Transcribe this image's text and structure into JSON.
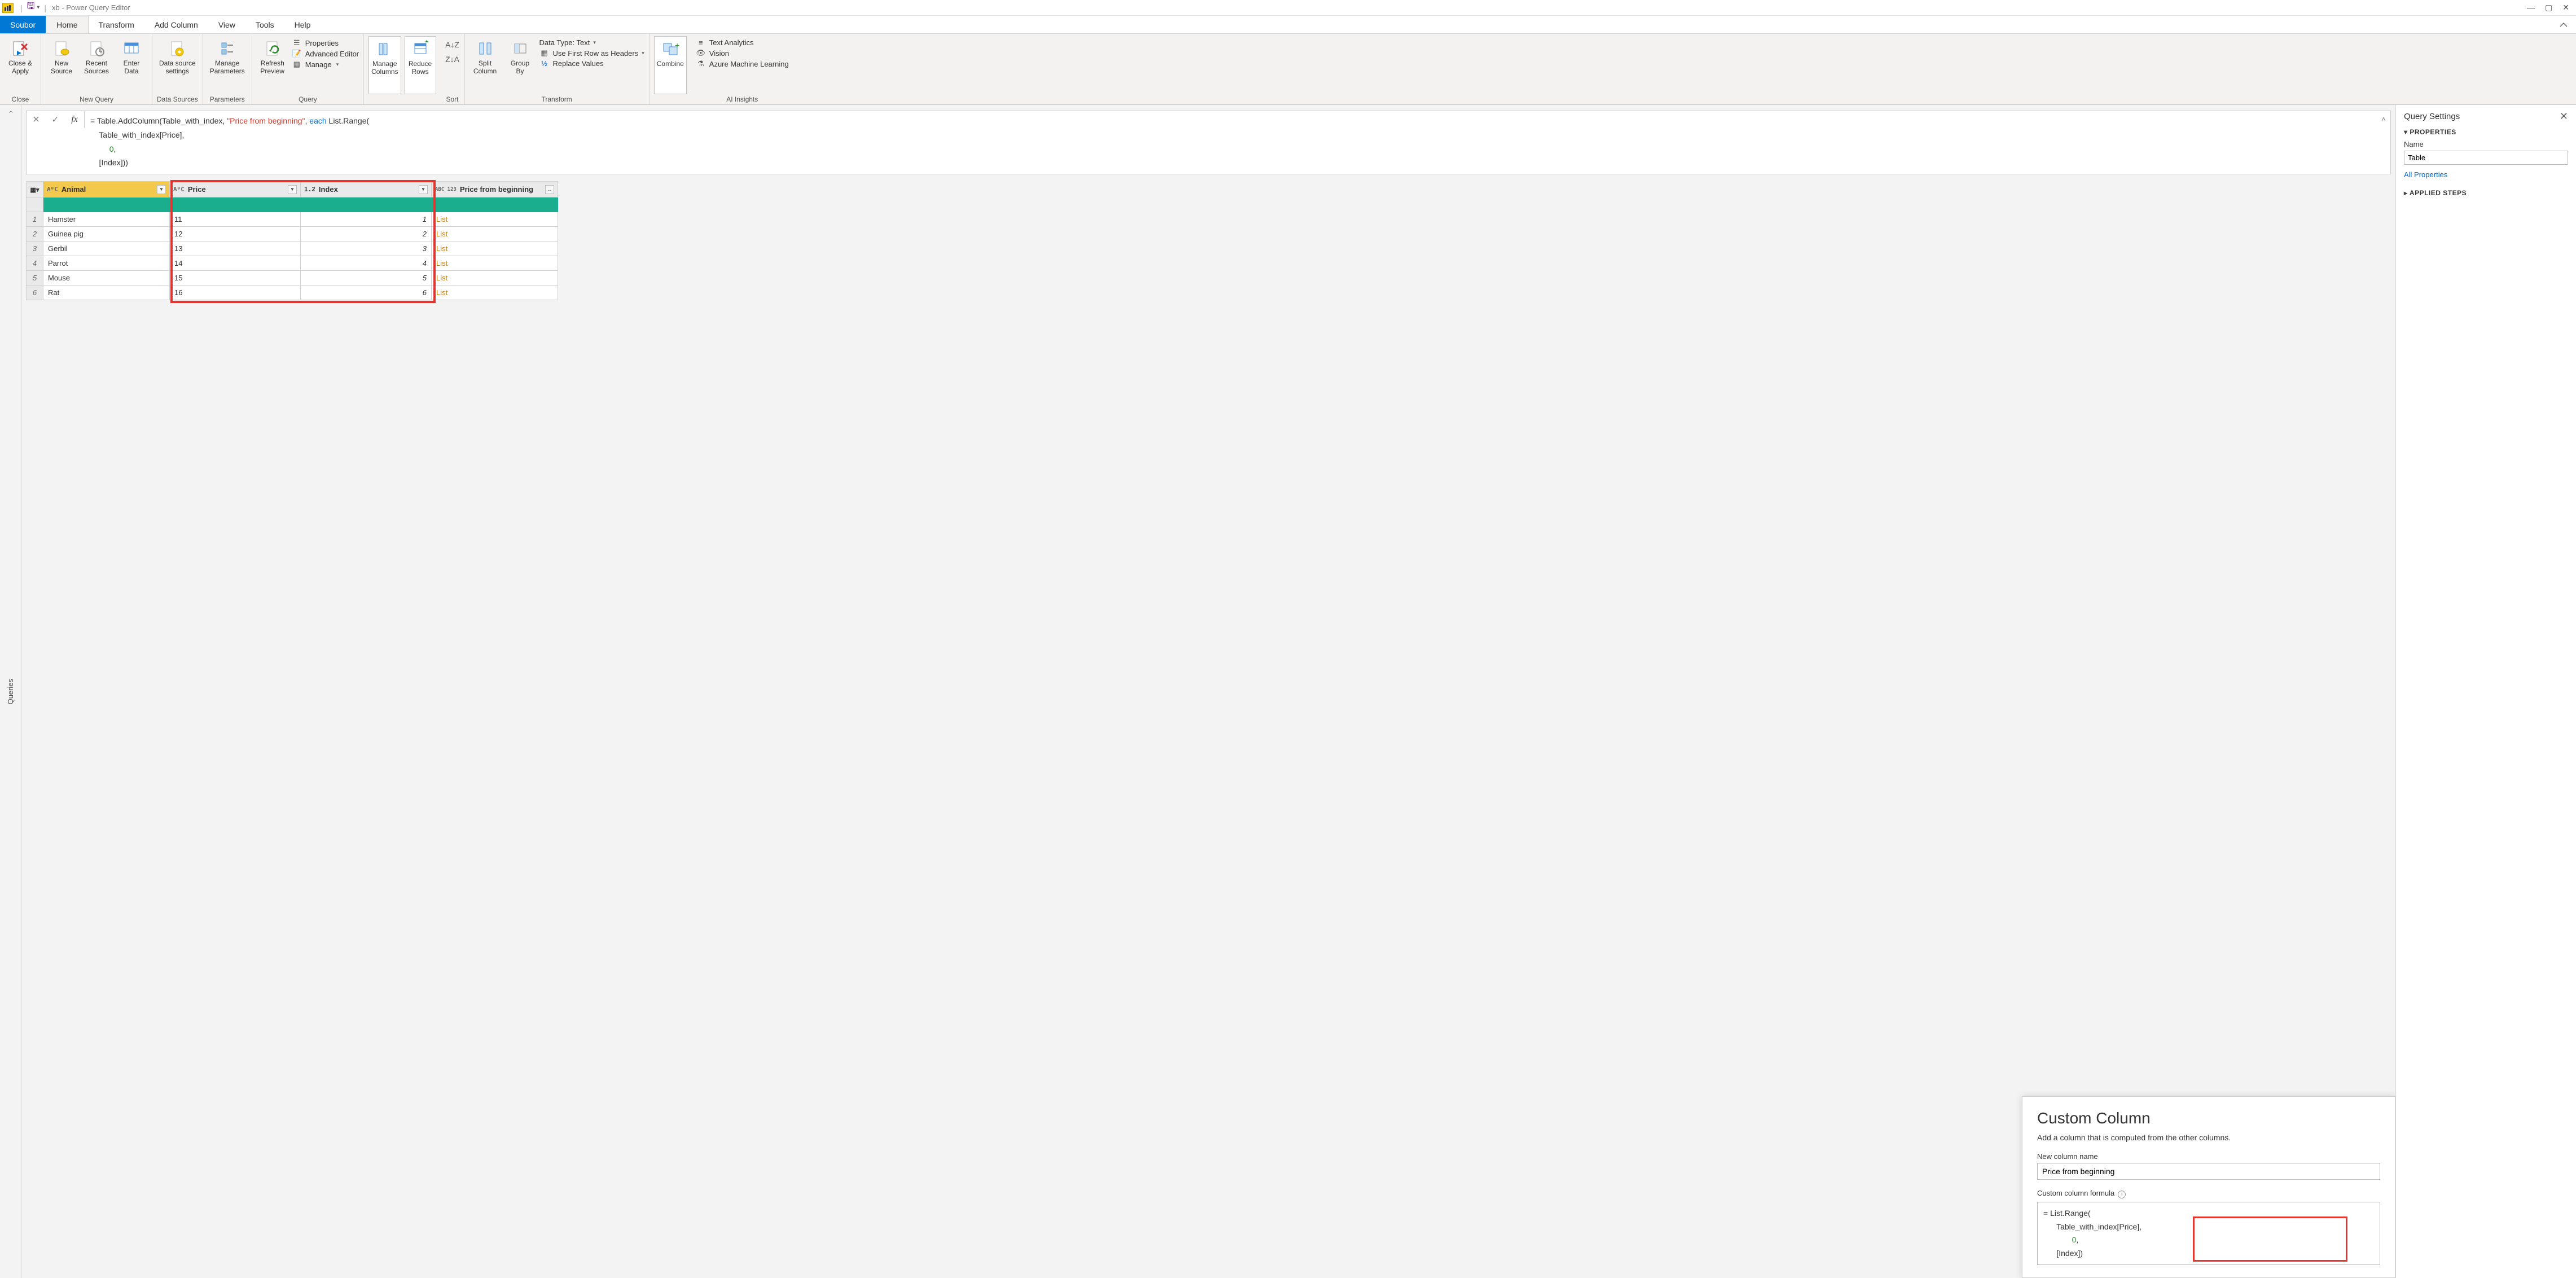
{
  "titlebar": {
    "title": "xb - Power Query Editor"
  },
  "menu": {
    "file": "Soubor",
    "tabs": [
      "Home",
      "Transform",
      "Add Column",
      "View",
      "Tools",
      "Help"
    ],
    "active": "Home"
  },
  "ribbon": {
    "close": {
      "btn": "Close &\nApply",
      "group": "Close"
    },
    "newquery": {
      "new": "New\nSource",
      "recent": "Recent\nSources",
      "enter": "Enter\nData",
      "group": "New Query"
    },
    "datasources": {
      "btn": "Data source\nsettings",
      "group": "Data Sources"
    },
    "parameters": {
      "btn": "Manage\nParameters",
      "group": "Parameters"
    },
    "query": {
      "refresh": "Refresh\nPreview",
      "props": "Properties",
      "adv": "Advanced Editor",
      "manage": "Manage",
      "group": "Query"
    },
    "managecols": {
      "manage": "Manage\nColumns",
      "reduce": "Reduce\nRows"
    },
    "sort": {
      "group": "Sort"
    },
    "transform": {
      "split": "Split\nColumn",
      "groupby": "Group\nBy",
      "datatype": "Data Type: Text",
      "firstrow": "Use First Row as Headers",
      "replace": "Replace Values",
      "group": "Transform"
    },
    "combine": {
      "btn": "Combine"
    },
    "ai": {
      "text": "Text Analytics",
      "vision": "Vision",
      "aml": "Azure Machine Learning",
      "group": "AI Insights"
    }
  },
  "queries_pane": {
    "label": "Queries"
  },
  "formula": {
    "line1_a": "= Table.AddColumn(Table_with_index, ",
    "line1_str": "\"Price from beginning\"",
    "line1_b": ", ",
    "line1_kw": "each",
    "line1_c": " List.Range(",
    "line2": "    Table_with_index[Price],",
    "line3_num": "0",
    "line3_b": ",",
    "line4": "    [Index]))"
  },
  "table": {
    "columns": [
      {
        "type": "AᴮC",
        "name": "Animal"
      },
      {
        "type": "AᴮC",
        "name": "Price"
      },
      {
        "type": "1.2",
        "name": "Index"
      },
      {
        "type": "ABC\n123",
        "name": "Price from beginning"
      }
    ],
    "rows": [
      {
        "n": "1",
        "animal": "Hamster",
        "price": "11",
        "index": "1",
        "prf": "List"
      },
      {
        "n": "2",
        "animal": "Guinea pig",
        "price": "12",
        "index": "2",
        "prf": "List"
      },
      {
        "n": "3",
        "animal": "Gerbil",
        "price": "13",
        "index": "3",
        "prf": "List"
      },
      {
        "n": "4",
        "animal": "Parrot",
        "price": "14",
        "index": "4",
        "prf": "List"
      },
      {
        "n": "5",
        "animal": "Mouse",
        "price": "15",
        "index": "5",
        "prf": "List"
      },
      {
        "n": "6",
        "animal": "Rat",
        "price": "16",
        "index": "6",
        "prf": "List"
      }
    ]
  },
  "settings": {
    "title": "Query Settings",
    "properties": "PROPERTIES",
    "name_label": "Name",
    "name_value": "Table",
    "all_props": "All Properties",
    "applied": "APPLIED STEPS"
  },
  "dialog": {
    "title": "Custom Column",
    "subtitle": "Add a column that is computed from the other columns.",
    "name_label": "New column name",
    "name_value": "Price from beginning",
    "formula_label": "Custom column formula",
    "code_l1": "= List.Range(",
    "code_l2": "      Table_with_index[Price],",
    "code_l3_num": "0",
    "code_l3_b": ",",
    "code_l4": "      [Index])"
  }
}
